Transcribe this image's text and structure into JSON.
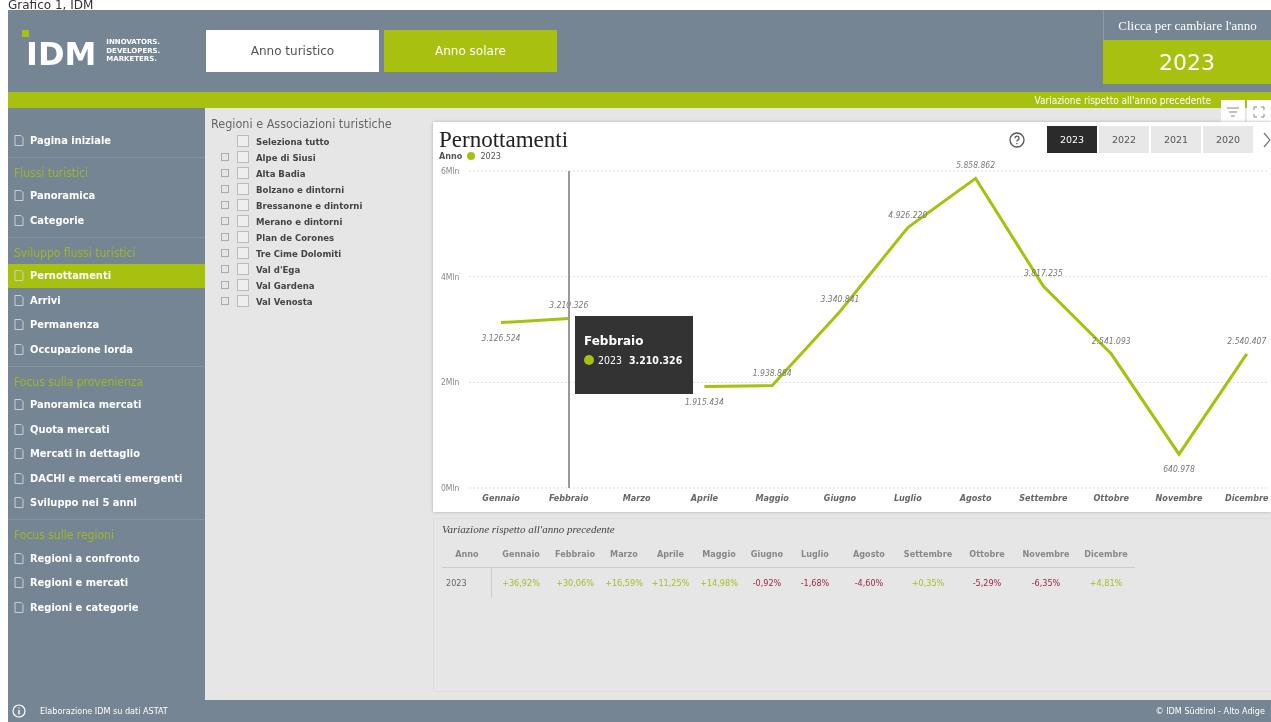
{
  "caption": "Grafico 1, IDM",
  "logo": {
    "mark": "IDM",
    "tagline": [
      "INNOVATORS.",
      "DEVELOPERS.",
      "MARKETERS."
    ]
  },
  "year_tabs": [
    {
      "label": "Anno turistico",
      "selected": false
    },
    {
      "label": "Anno solare",
      "selected": true
    }
  ],
  "year_picker": {
    "hint": "Clicca per cambiare l'anno",
    "value": "2023"
  },
  "banner": "Variazione rispetto all'anno precedente",
  "sidebar": {
    "items": [
      {
        "kind": "link",
        "label": "Pagina iniziale",
        "selected": false
      },
      {
        "kind": "section",
        "label": "Flussi turistici"
      },
      {
        "kind": "link",
        "label": "Panoramica",
        "selected": false
      },
      {
        "kind": "link",
        "label": "Categorie",
        "selected": false
      },
      {
        "kind": "section",
        "label": "Sviluppo flussi turistici"
      },
      {
        "kind": "link",
        "label": "Pernottamenti",
        "selected": true
      },
      {
        "kind": "link",
        "label": "Arrivi",
        "selected": false
      },
      {
        "kind": "link",
        "label": "Permanenza",
        "selected": false
      },
      {
        "kind": "link",
        "label": "Occupazione lorda",
        "selected": false
      },
      {
        "kind": "section",
        "label": "Focus sulla provenienza"
      },
      {
        "kind": "link",
        "label": "Panoramica mercati",
        "selected": false
      },
      {
        "kind": "link",
        "label": "Quota mercati",
        "selected": false
      },
      {
        "kind": "link",
        "label": "Mercati in dettaglio",
        "selected": false
      },
      {
        "kind": "link",
        "label": "DACHI e mercati emergenti",
        "selected": false
      },
      {
        "kind": "link",
        "label": "Sviluppo nei 5 anni",
        "selected": false
      },
      {
        "kind": "section",
        "label": "Focus sulle regioni"
      },
      {
        "kind": "link",
        "label": "Regioni a confronto",
        "selected": false
      },
      {
        "kind": "link",
        "label": "Regioni e mercati",
        "selected": false
      },
      {
        "kind": "link",
        "label": "Regioni e categorie",
        "selected": false
      }
    ]
  },
  "filter": {
    "title": "Regioni e Associazioni turistiche",
    "select_all": {
      "label": "Seleziona tutto",
      "checked": false
    },
    "items": [
      {
        "label": "Alpe di Siusi",
        "checked": false
      },
      {
        "label": "Alta Badia",
        "checked": false
      },
      {
        "label": "Bolzano e dintorni",
        "checked": false
      },
      {
        "label": "Bressanone e dintorni",
        "checked": false
      },
      {
        "label": "Merano e dintorni",
        "checked": false
      },
      {
        "label": "Plan de Corones",
        "checked": false
      },
      {
        "label": "Tre Cime Dolomiti",
        "checked": false
      },
      {
        "label": "Val d'Ega",
        "checked": false
      },
      {
        "label": "Val Gardena",
        "checked": false
      },
      {
        "label": "Val Venosta",
        "checked": false
      }
    ]
  },
  "chart_card": {
    "title": "Pernottamenti",
    "years": [
      {
        "label": "2023",
        "selected": true
      },
      {
        "label": "2022",
        "selected": false
      },
      {
        "label": "2021",
        "selected": false
      },
      {
        "label": "2020",
        "selected": false
      }
    ],
    "legend_title": "Anno",
    "chart_data": {
      "type": "line",
      "categories": [
        "Gennaio",
        "Febbraio",
        "Marzo",
        "Aprile",
        "Maggio",
        "Giugno",
        "Luglio",
        "Agosto",
        "Settembre",
        "Ottobre",
        "Novembre",
        "Dicembre"
      ],
      "series": [
        {
          "name": "2023",
          "color": "#a8c010",
          "values": [
            3.13,
            3.21,
            null,
            1.92,
            1.94,
            3.34,
            4.93,
            5.86,
            3.82,
            2.54,
            0.64,
            2.54
          ]
        }
      ],
      "value_labels": [
        "3.126.524",
        "3.210.326",
        null,
        "1.915.434",
        "1.938.884",
        "3.340.841",
        "4.926.220",
        "5.858.862",
        "3.817.235",
        "2.541.093",
        "640.978",
        "2.540.407"
      ],
      "ylim": [
        0,
        6
      ],
      "yticks": [
        {
          "value": 0,
          "label": "0Mln"
        },
        {
          "value": 2,
          "label": "2Mln"
        },
        {
          "value": 4,
          "label": "4Mln"
        },
        {
          "value": 6,
          "label": "6Mln"
        }
      ]
    },
    "tooltip": {
      "title": "Febbraio",
      "series": "2023",
      "value": "3.210.326"
    }
  },
  "variation_table": {
    "title": "Variazione rispetto all'anno precedente",
    "columns": [
      "Anno",
      "Gennaio",
      "Febbraio",
      "Marzo",
      "Aprile",
      "Maggio",
      "Giugno",
      "Luglio",
      "Agosto",
      "Settembre",
      "Ottobre",
      "Novembre",
      "Dicembre"
    ],
    "rows": [
      {
        "cells": [
          {
            "text": "2023",
            "kind": "year"
          },
          {
            "text": "+36,92%",
            "kind": "positive"
          },
          {
            "text": "+30,06%",
            "kind": "positive"
          },
          {
            "text": "+16,59%",
            "kind": "positive"
          },
          {
            "text": "+11,25%",
            "kind": "positive"
          },
          {
            "text": "+14,98%",
            "kind": "positive"
          },
          {
            "text": "-0,92%",
            "kind": "negative"
          },
          {
            "text": "-1,68%",
            "kind": "negative"
          },
          {
            "text": "-4,60%",
            "kind": "negative"
          },
          {
            "text": "+0,35%",
            "kind": "positive"
          },
          {
            "text": "-5,29%",
            "kind": "negative"
          },
          {
            "text": "-6,35%",
            "kind": "negative"
          },
          {
            "text": "+4,81%",
            "kind": "positive"
          }
        ]
      }
    ]
  },
  "footer": {
    "source": "Elaborazione IDM su dati ASTAT",
    "copyright": "© IDM Südtirol - Alto Adige"
  }
}
